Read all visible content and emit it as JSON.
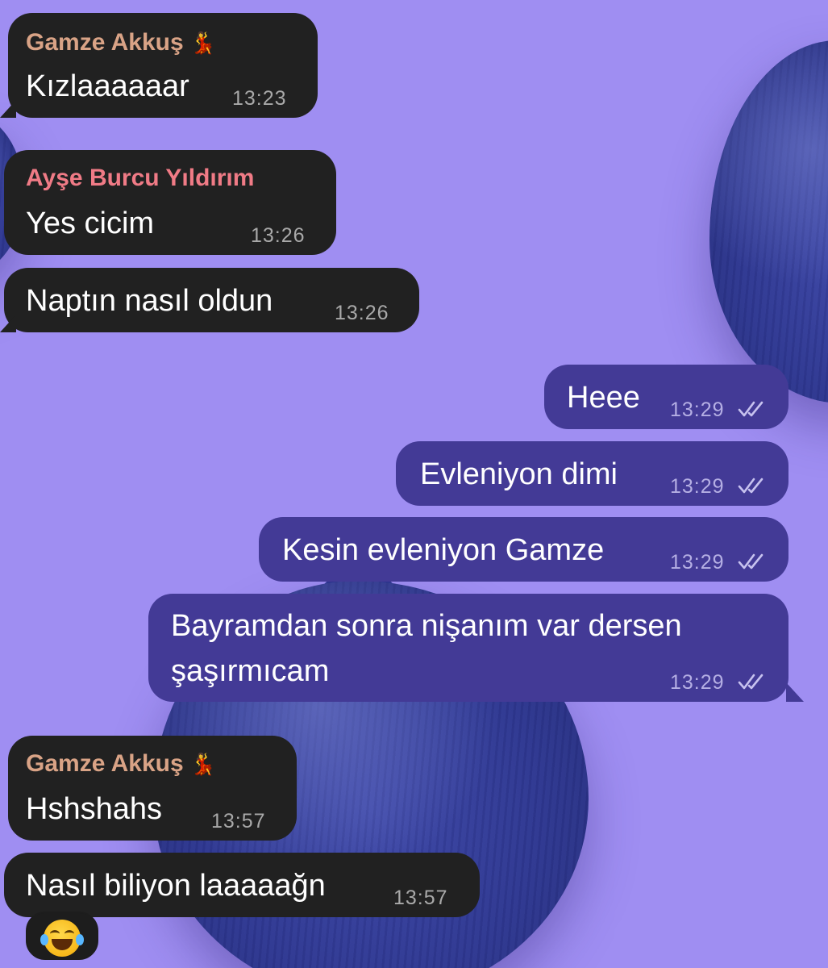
{
  "colors": {
    "wallpaper": "#9f8ef2",
    "incoming_bubble": "#212121",
    "outgoing_bubble": "#433a96",
    "sender_gamze": "#d9a386",
    "sender_ayse": "#f07b86",
    "read_check": "#c7c2ef"
  },
  "messages": [
    {
      "direction": "in",
      "sender": "Gamze Akkuş",
      "sender_emoji": "💃",
      "text": "Kızlaaaaaar",
      "time": "13:23"
    },
    {
      "direction": "in",
      "sender": "Ayşe Burcu Yıldırım",
      "text": "Yes cicim",
      "time": "13:26"
    },
    {
      "direction": "in",
      "text": "Naptın nasıl oldun",
      "time": "13:26"
    },
    {
      "direction": "out",
      "text": "Heee",
      "time": "13:29",
      "status": "double-check-read"
    },
    {
      "direction": "out",
      "text": "Evleniyon dimi",
      "time": "13:29",
      "status": "double-check-read"
    },
    {
      "direction": "out",
      "text": "Kesin evleniyon Gamze",
      "time": "13:29",
      "status": "double-check-read"
    },
    {
      "direction": "out",
      "text": "Bayramdan sonra nişanım var dersen şaşırmıcam",
      "time": "13:29",
      "status": "double-check-read"
    },
    {
      "direction": "in",
      "sender": "Gamze Akkuş",
      "sender_emoji": "💃",
      "text": "Hshshahs",
      "time": "13:57"
    },
    {
      "direction": "in",
      "text": "Nasıl biliyon laaaaağn",
      "time": "13:57"
    },
    {
      "direction": "in",
      "emoji": "face-with-tears-of-joy"
    }
  ]
}
